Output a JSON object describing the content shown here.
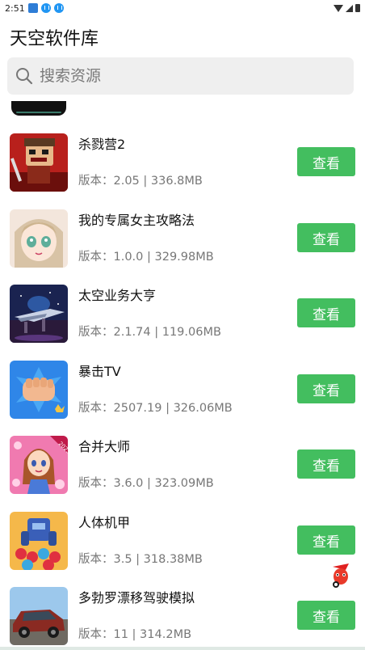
{
  "status_bar": {
    "time": "2:51"
  },
  "header": {
    "title": "天空软件库"
  },
  "search": {
    "placeholder": "搜索资源"
  },
  "items": [
    {
      "name": "杀戮营2",
      "meta": "版本：2.05 | 336.8MB",
      "button": "查看"
    },
    {
      "name": "我的专属女主攻略法",
      "meta": "版本：1.0.0 | 329.98MB",
      "button": "查看"
    },
    {
      "name": "太空业务大亨",
      "meta": "版本：2.1.74 | 119.06MB",
      "button": "查看"
    },
    {
      "name": "暴击TV",
      "meta": "版本：2507.19 | 326.06MB",
      "button": "查看"
    },
    {
      "name": "合并大师",
      "meta": "版本：3.6.0 | 323.09MB",
      "button": "查看"
    },
    {
      "name": "人体机甲",
      "meta": "版本：3.5 | 318.38MB",
      "button": "查看"
    },
    {
      "name": "多勃罗漂移驾驶模拟",
      "meta": "版本：11 | 314.2MB",
      "button": "查看"
    }
  ],
  "thumb_badge": "2025",
  "colors": {
    "accent": "#43be5f",
    "search_bg": "#efefef"
  }
}
